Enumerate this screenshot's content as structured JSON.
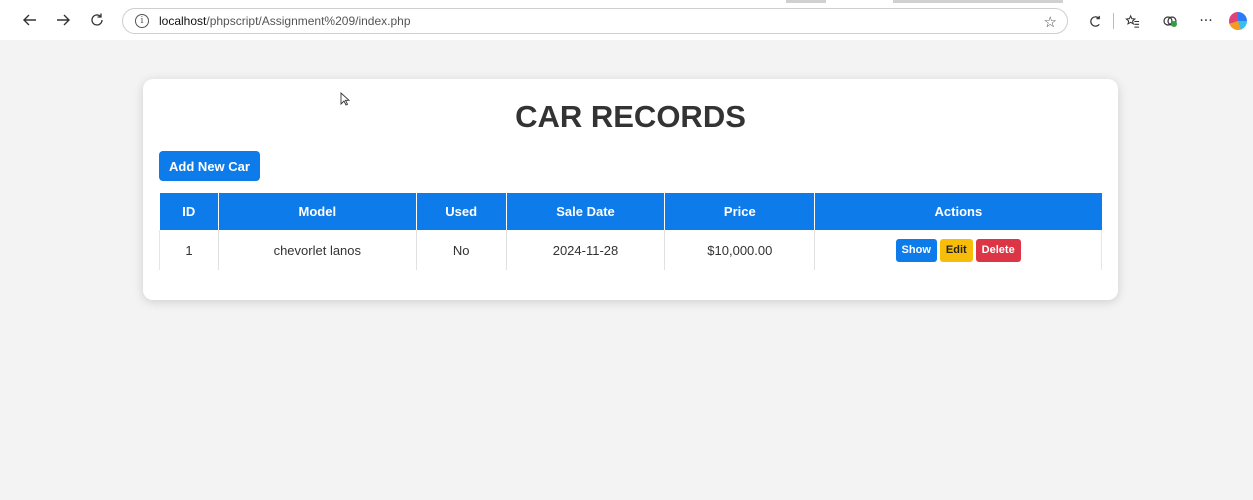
{
  "browser": {
    "url_host": "localhost",
    "url_path": "/phpscript/Assignment%209/index.php"
  },
  "page": {
    "title": "CAR RECORDS",
    "add_button_label": "Add New Car"
  },
  "table": {
    "headers": [
      "ID",
      "Model",
      "Used",
      "Sale Date",
      "Price",
      "Actions"
    ],
    "rows": [
      {
        "id": "1",
        "model": "chevorlet lanos",
        "used": "No",
        "sale_date": "2024-11-28",
        "price": "$10,000.00",
        "actions": [
          "Show",
          "Edit",
          "Delete"
        ]
      }
    ]
  },
  "colors": {
    "primary": "#0d7bea",
    "warning": "#f8bd08",
    "danger": "#dc3546",
    "background": "#f3f3f3"
  },
  "icons": [
    "back-icon",
    "forward-icon",
    "refresh-icon",
    "info-icon",
    "star-icon",
    "refresh-alt-icon",
    "favorites-icon",
    "extensions-icon",
    "more-icon",
    "copilot-icon"
  ]
}
